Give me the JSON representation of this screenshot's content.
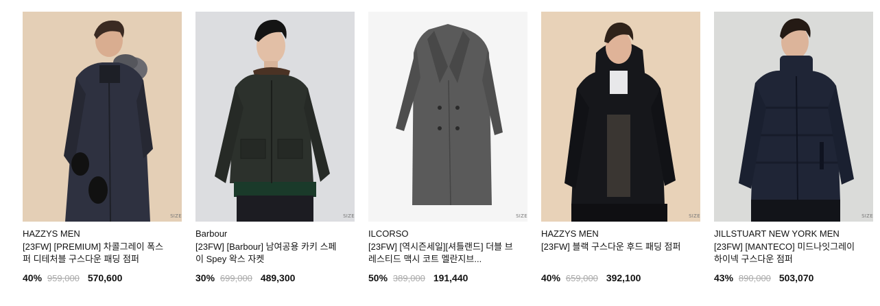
{
  "products": [
    {
      "brand": "HAZZYS MEN",
      "title": "[23FW] [PREMIUM] 차콜그레이 폭스퍼 디테처블 구스다운 패딩 점퍼",
      "size_tag": "SIZE",
      "discount": "40%",
      "original_price": "959,000",
      "sale_price": "570,600",
      "image": "model-in-navy-fur-hood-parka",
      "bg_color": "#e4cfb6",
      "garment_color": "#2e3140"
    },
    {
      "brand": "Barbour",
      "title": "[23FW] [Barbour] 남여공용 카키 스페이 Spey 왁스 자켓",
      "size_tag": "SIZE",
      "discount": "30%",
      "original_price": "699,000",
      "sale_price": "489,300",
      "image": "model-in-waxed-jacket",
      "bg_color": "#dcdde0",
      "garment_color": "#2c312c"
    },
    {
      "brand": "ILCORSO",
      "title": "[23FW] [역시즌세일][셔틀랜드] 더블 브레스티드 맥시 코트 멜란지브...",
      "size_tag": "SIZE",
      "discount": "50%",
      "original_price": "389,000",
      "sale_price": "191,440",
      "image": "grey-double-breasted-coat",
      "bg_color": "#f5f5f5",
      "garment_color": "#5a5a5a"
    },
    {
      "brand": "HAZZYS MEN",
      "title": "[23FW] 블랙 구스다운 후드 패딩 점퍼",
      "size_tag": "SIZE",
      "discount": "40%",
      "original_price": "659,000",
      "sale_price": "392,100",
      "image": "model-in-black-hooded-down-jacket",
      "bg_color": "#e8d2b8",
      "garment_color": "#16171b"
    },
    {
      "brand": "JILLSTUART NEW YORK MEN",
      "title": "[23FW] [MANTECO] 미드나잇그레이 하이넥 구스다운 점퍼",
      "size_tag": "SIZE",
      "discount": "43%",
      "original_price": "890,000",
      "sale_price": "503,070",
      "image": "model-in-navy-puffer-jacket",
      "bg_color": "#dadbd9",
      "garment_color": "#1f2536"
    }
  ]
}
